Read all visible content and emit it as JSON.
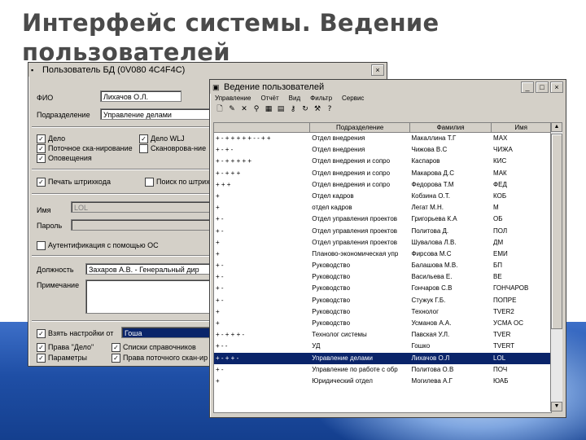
{
  "slide_title": "Интерфейс системы. Ведение пользователей",
  "user_window": {
    "title": "Пользователь БД   (0V080 4C4F4C)",
    "fio_label": "ФИО",
    "fio_value": "Лихачов О.Л.",
    "dept_label": "Подразделение",
    "dept_value": "Управление делами",
    "checks1": [
      {
        "label": "Дело",
        "checked": true
      },
      {
        "label": "Дело WLJ",
        "checked": true
      },
      {
        "label": "Поточное ска-нирование",
        "checked": true
      },
      {
        "label": "Скановрова-ние",
        "checked": false
      },
      {
        "label": "Оповещения",
        "checked": true
      }
    ],
    "print_label": "Печать штрихкода",
    "search_label": "Поиск по штрихкоду",
    "name_label": "Имя",
    "name_value": "LOL",
    "password_label": "Пароль",
    "auth_label": "Аутентификация с помощью ОС",
    "position_label": "Должность",
    "position_value": "Захаров А.В. - Генеральный дир",
    "note_label": "Примечание",
    "take_settings_label": "Взять настройки от",
    "take_settings_value": "Гоша",
    "checks2": [
      {
        "label": "Права \"Дело\"",
        "checked": true
      },
      {
        "label": "Списки справочников",
        "checked": true
      },
      {
        "label": "Параметры",
        "checked": true
      },
      {
        "label": "Права поточного скан-ир",
        "checked": true
      }
    ]
  },
  "users_window": {
    "title": "Ведение пользователей",
    "menu": [
      "Управление",
      "Отчёт",
      "Вид",
      "Фильтр",
      "Сервис"
    ],
    "columns": [
      "",
      "Подразделение",
      "Фамилия",
      "Имя"
    ],
    "rows": [
      {
        "flags": "+ - + + + + + - - + +",
        "dept": "Отдел внедрения",
        "name": "Макаллина Т.Г",
        "login": "МАХ"
      },
      {
        "flags": "+ -     +          -",
        "dept": "Отдел внедрения",
        "name": "Чижова В.С",
        "login": "ЧИЖА"
      },
      {
        "flags": "+ - + + + + +",
        "dept": "Отдел внедрения и сопро",
        "name": "Каспаров",
        "login": "КИС"
      },
      {
        "flags": "+ - + + +",
        "dept": "Отдел внедрения и сопро",
        "name": "Макарова Д.С",
        "login": "МАК"
      },
      {
        "flags": "+ +    +",
        "dept": "Отдел внедрения и сопро",
        "name": "Федорова Т.М",
        "login": "ФЕД"
      },
      {
        "flags": "+",
        "dept": "Отдел кадров",
        "name": "Кобзина О.Т.",
        "login": "КОБ"
      },
      {
        "flags": "+",
        "dept": "отдел кадров",
        "name": "Легат М.Н.",
        "login": "М"
      },
      {
        "flags": "+ -",
        "dept": "Отдел управления проектов",
        "name": "Григорьева К.А",
        "login": "ОБ"
      },
      {
        "flags": "+ -",
        "dept": "Отдел управления проектов",
        "name": "Политова Д.",
        "login": "ПОЛ"
      },
      {
        "flags": "+",
        "dept": "Отдел управления проектов",
        "name": "Шувалова Л.В.",
        "login": "ДМ"
      },
      {
        "flags": "+",
        "dept": "Планово-экономическая упр",
        "name": "Фирсова М.С",
        "login": "ЕМИ"
      },
      {
        "flags": "+ -",
        "dept": "Руководство",
        "name": "Балашова М.В.",
        "login": "БП"
      },
      {
        "flags": "+ -",
        "dept": "Руководство",
        "name": "Васильева Е.",
        "login": "ВЕ"
      },
      {
        "flags": "+ -",
        "dept": "Руководство",
        "name": "Гончаров С.В",
        "login": "ГОНЧАРОВ"
      },
      {
        "flags": "+ -",
        "dept": "Руководство",
        "name": "Стужук Г.Б.",
        "login": "ПОПРЕ"
      },
      {
        "flags": "+",
        "dept": "Руководство",
        "name": "Технолог",
        "login": "TVER2"
      },
      {
        "flags": "+",
        "dept": "Руководство",
        "name": "Усманов А.А.",
        "login": "УСМА ОС"
      },
      {
        "flags": "+ - + + +     -",
        "dept": "Технолог системы",
        "name": "Павская У.Л.",
        "login": "TVER"
      },
      {
        "flags": "+ -          -",
        "dept": "УД",
        "name": "Гошко",
        "login": "TVERT"
      },
      {
        "flags": "+ -    + +    -",
        "dept": "Управление делами",
        "name": "Лихачов О.Л",
        "login": "LOL",
        "selected": true
      },
      {
        "flags": "+ -",
        "dept": "Управление по работе с обр",
        "name": "Политова О.В",
        "login": "ПОЧ"
      },
      {
        "flags": "+",
        "dept": "Юридический отдел",
        "name": "Могилева А.Г",
        "login": "ЮАБ"
      }
    ]
  }
}
